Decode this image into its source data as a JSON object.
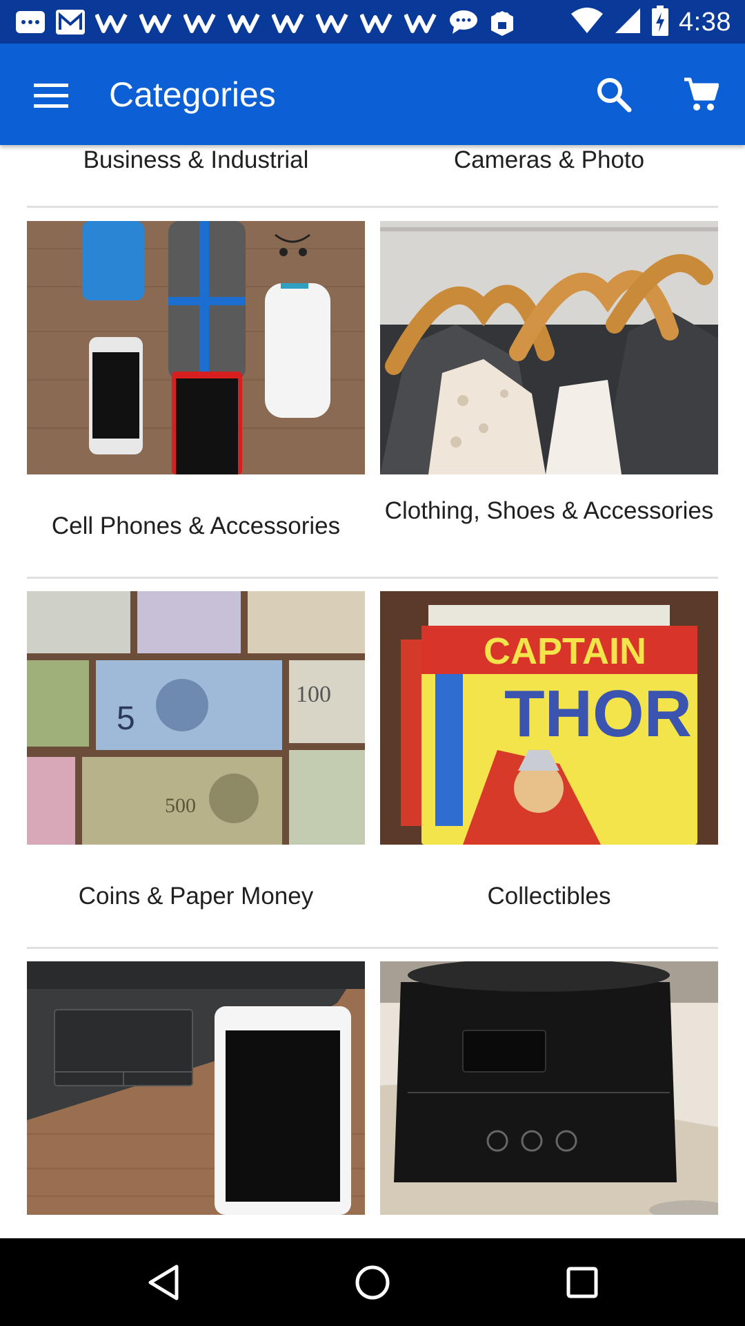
{
  "status_bar": {
    "time": "4:38",
    "notification_icons": [
      "chat-icon",
      "gmail-icon",
      "w-icon",
      "w-icon",
      "w-icon",
      "w-icon",
      "w-icon",
      "w-icon",
      "w-icon",
      "w-icon",
      "message-icon",
      "android-box-icon"
    ],
    "system_icons": [
      "wifi-icon",
      "cellular-signal-icon",
      "battery-charging-icon"
    ]
  },
  "app_bar": {
    "title": "Categories",
    "menu_icon": "hamburger-menu-icon",
    "search_icon": "search-icon",
    "cart_icon": "shopping-cart-icon",
    "color": "#0c5fd4"
  },
  "categories": [
    {
      "label": "Business & Industrial"
    },
    {
      "label": "Cameras & Photo"
    },
    {
      "label": "Cell Phones & Accessories"
    },
    {
      "label": "Clothing, Shoes & Accessories"
    },
    {
      "label": "Coins & Paper Money"
    },
    {
      "label": "Collectibles"
    },
    {
      "label": ""
    },
    {
      "label": ""
    }
  ],
  "nav_bar": {
    "back_icon": "back-triangle-icon",
    "home_icon": "home-circle-icon",
    "recents_icon": "recents-square-icon"
  }
}
